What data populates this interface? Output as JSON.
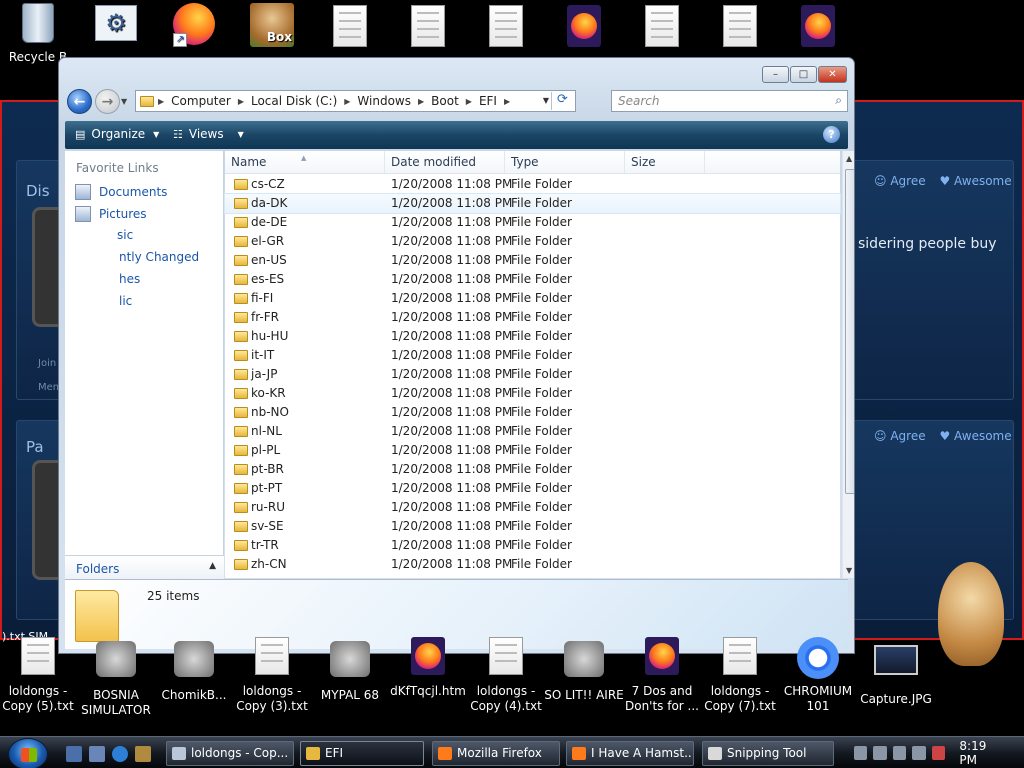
{
  "desktop": {
    "top_icons": [
      {
        "label": "Recycle Bin",
        "type": "recycle"
      },
      {
        "label": "",
        "type": "gear"
      },
      {
        "label": "",
        "type": "firefox"
      },
      {
        "label": "",
        "type": "box-hamster"
      },
      {
        "label": "",
        "type": "document"
      },
      {
        "label": "",
        "type": "document"
      },
      {
        "label": "",
        "type": "document"
      },
      {
        "label": "",
        "type": "firefox"
      },
      {
        "label": "",
        "type": "document"
      },
      {
        "label": "",
        "type": "document"
      },
      {
        "label": "",
        "type": "firefox"
      }
    ],
    "box_label": "Box",
    "recycle_label": "Recycle B",
    "bottom_icons": [
      {
        "label": "loldongs - Copy (5).txt"
      },
      {
        "label": "BOSNIA SIMULATOR"
      },
      {
        "label": "ChomikB..."
      },
      {
        "label": "loldongs - Copy (3).txt"
      },
      {
        "label": "MYPAL 68"
      },
      {
        "label": "dKfTqcjl.htm"
      },
      {
        "label": "loldongs - Copy (4).txt"
      },
      {
        "label": "SO LIT!! AIRE"
      },
      {
        "label": "7 Dos and Don'ts for ..."
      },
      {
        "label": "loldongs - Copy (7).txt"
      },
      {
        "label": "CHROMIUM 101"
      },
      {
        "label": "Capture.JPG"
      }
    ]
  },
  "background_window": {
    "heading1": "Dis",
    "heading2": "Pa",
    "agree": "Agree",
    "awesome": "Awesome",
    "snippet": "sidering people buy",
    "side_small1": "Join",
    "side_small2": "Mem",
    "left_fragment": ").txt SIM"
  },
  "explorer": {
    "title_buttons": {
      "minimize": "–",
      "maximize": "□",
      "close": "✕"
    },
    "breadcrumb": [
      "Computer",
      "Local Disk (C:)",
      "Windows",
      "Boot",
      "EFI"
    ],
    "search_placeholder": "Search",
    "toolbar": {
      "organize": "Organize",
      "views": "Views",
      "help": "?"
    },
    "nav": {
      "heading": "Favorite Links",
      "links": [
        "Documents",
        "Pictures",
        "Music",
        "Recently Changed",
        "Searches",
        "Public"
      ],
      "link_fragments": [
        "Documents",
        "Pictures",
        "sic",
        "ntly Changed",
        "hes",
        "lic"
      ],
      "folders": "Folders"
    },
    "columns": [
      "Name",
      "Date modified",
      "Type",
      "Size"
    ],
    "rows": [
      {
        "name": "cs-CZ",
        "date": "1/20/2008 11:08 PM",
        "type": "File Folder"
      },
      {
        "name": "da-DK",
        "date": "1/20/2008 11:08 PM",
        "type": "File Folder"
      },
      {
        "name": "de-DE",
        "date": "1/20/2008 11:08 PM",
        "type": "File Folder"
      },
      {
        "name": "el-GR",
        "date": "1/20/2008 11:08 PM",
        "type": "File Folder"
      },
      {
        "name": "en-US",
        "date": "1/20/2008 11:08 PM",
        "type": "File Folder"
      },
      {
        "name": "es-ES",
        "date": "1/20/2008 11:08 PM",
        "type": "File Folder"
      },
      {
        "name": "fi-FI",
        "date": "1/20/2008 11:08 PM",
        "type": "File Folder"
      },
      {
        "name": "fr-FR",
        "date": "1/20/2008 11:08 PM",
        "type": "File Folder"
      },
      {
        "name": "hu-HU",
        "date": "1/20/2008 11:08 PM",
        "type": "File Folder"
      },
      {
        "name": "it-IT",
        "date": "1/20/2008 11:08 PM",
        "type": "File Folder"
      },
      {
        "name": "ja-JP",
        "date": "1/20/2008 11:08 PM",
        "type": "File Folder"
      },
      {
        "name": "ko-KR",
        "date": "1/20/2008 11:08 PM",
        "type": "File Folder"
      },
      {
        "name": "nb-NO",
        "date": "1/20/2008 11:08 PM",
        "type": "File Folder"
      },
      {
        "name": "nl-NL",
        "date": "1/20/2008 11:08 PM",
        "type": "File Folder"
      },
      {
        "name": "pl-PL",
        "date": "1/20/2008 11:08 PM",
        "type": "File Folder"
      },
      {
        "name": "pt-BR",
        "date": "1/20/2008 11:08 PM",
        "type": "File Folder"
      },
      {
        "name": "pt-PT",
        "date": "1/20/2008 11:08 PM",
        "type": "File Folder"
      },
      {
        "name": "ru-RU",
        "date": "1/20/2008 11:08 PM",
        "type": "File Folder"
      },
      {
        "name": "sv-SE",
        "date": "1/20/2008 11:08 PM",
        "type": "File Folder"
      },
      {
        "name": "tr-TR",
        "date": "1/20/2008 11:08 PM",
        "type": "File Folder"
      },
      {
        "name": "zh-CN",
        "date": "1/20/2008 11:08 PM",
        "type": "File Folder"
      }
    ],
    "hover_row": 1,
    "item_count": "25 items"
  },
  "taskbar": {
    "tasks": [
      {
        "label": "loldongs - Cop...",
        "active": false
      },
      {
        "label": "EFI",
        "active": true
      },
      {
        "label": "Mozilla Firefox",
        "active": false
      },
      {
        "label": "I Have A Hamst...",
        "active": false
      },
      {
        "label": "Snipping Tool",
        "active": false
      }
    ],
    "clock": "8:19 PM"
  },
  "colors": {
    "accent": "#1a56a8",
    "frame_red": "#d21c1c",
    "folder": "#e6b83d"
  }
}
